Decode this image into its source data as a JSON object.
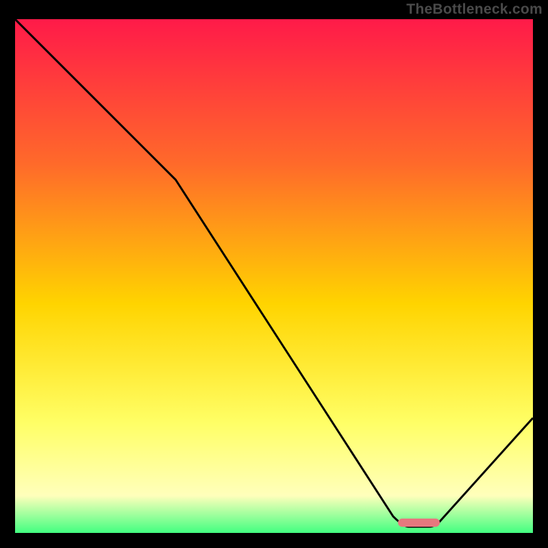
{
  "attribution": "TheBottleneck.com",
  "colors": {
    "bg": "#000000",
    "curve": "#000000",
    "marker": "#e6787e",
    "grad_top": "#ff1a49",
    "grad_mid_upper": "#ff6a2a",
    "grad_mid": "#ffd400",
    "grad_mid_lower": "#ffff66",
    "grad_pale": "#ffffbb",
    "grad_green": "#2dff7a"
  },
  "chart_data": {
    "type": "line",
    "title": "",
    "xlabel": "",
    "ylabel": "",
    "xlim": [
      0,
      100
    ],
    "ylim": [
      0,
      100
    ],
    "x": [
      0,
      25,
      75,
      81,
      100
    ],
    "values": [
      100,
      75,
      2,
      2,
      23
    ],
    "marker": {
      "x_start": 74,
      "x_end": 82,
      "y": 2
    },
    "gradient_stops": [
      {
        "pos": 0.0,
        "color": "#ff1a49"
      },
      {
        "pos": 0.28,
        "color": "#ff6a2a"
      },
      {
        "pos": 0.55,
        "color": "#ffd400"
      },
      {
        "pos": 0.78,
        "color": "#ffff66"
      },
      {
        "pos": 0.92,
        "color": "#ffffbb"
      },
      {
        "pos": 1.0,
        "color": "#2dff7a"
      }
    ]
  }
}
